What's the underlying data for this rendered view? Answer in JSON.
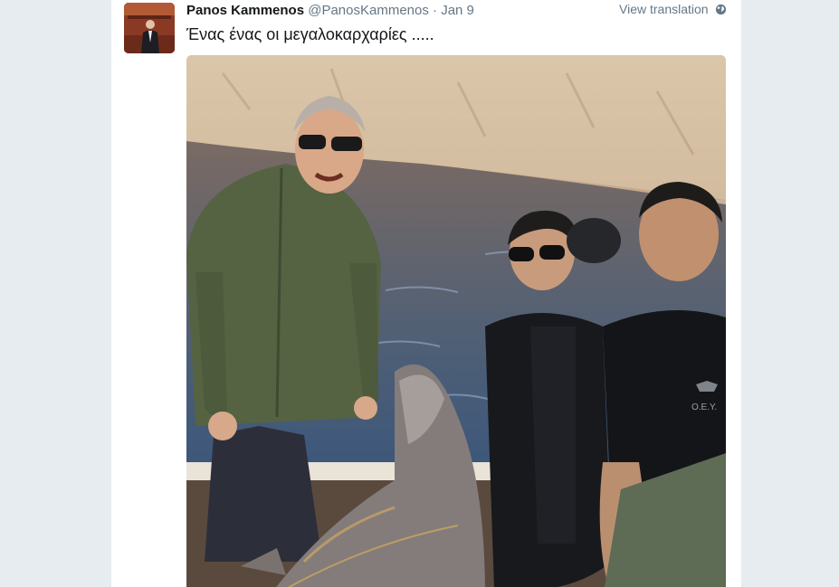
{
  "tweet": {
    "display_name": "Panos Kammenos",
    "username": "@PanosKammenos",
    "separator": "·",
    "timestamp": "Jan 9",
    "translate_label": "View translation",
    "text": "Ένας ένας οι μεγαλοκαρχαρίες .....",
    "translate_icon": "globe-icon",
    "photo_patch_text": "Ο.Ε.Υ."
  },
  "colors": {
    "page_bg": "#e6ecf0",
    "card_bg": "#ffffff",
    "name": "#14171a",
    "meta": "#657786"
  }
}
